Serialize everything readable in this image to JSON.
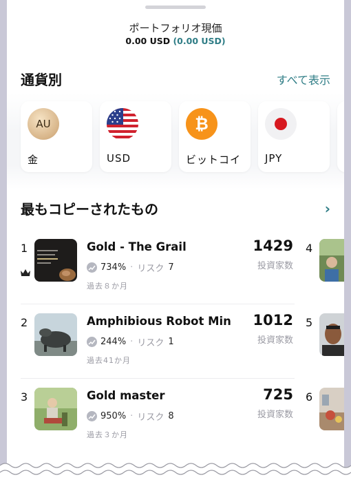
{
  "portfolio": {
    "title": "ポートフォリオ現価",
    "value": "0.00 USD",
    "change": "(0.00 USD)"
  },
  "currencies_section": {
    "title": "通貨別",
    "see_all": "すべて表示",
    "items": [
      {
        "label": "金",
        "icon": "gold-coin-icon",
        "icon_text": "AU"
      },
      {
        "label": "USD",
        "icon": "us-flag-icon"
      },
      {
        "label": "ビットコイ",
        "icon": "bitcoin-icon",
        "icon_text": "₿"
      },
      {
        "label": "JPY",
        "icon": "japan-flag-icon"
      }
    ]
  },
  "most_copied": {
    "title": "最もコピーされたもの",
    "rows": [
      {
        "rank": "1",
        "name": "Gold - The Grail",
        "return": "734%",
        "risk_label": "リスク",
        "risk": "7",
        "period": "過去８か月",
        "investors": "1429",
        "investors_label": "投資家数"
      },
      {
        "rank": "2",
        "name": "Amphibious Robot Min",
        "return": "244%",
        "risk_label": "リスク",
        "risk": "1",
        "period": "過去41か月",
        "investors": "1012",
        "investors_label": "投資家数"
      },
      {
        "rank": "3",
        "name": "Gold master",
        "return": "950%",
        "risk_label": "リスク",
        "risk": "8",
        "period": "過去３か月",
        "investors": "725",
        "investors_label": "投資家数"
      }
    ],
    "side_ranks": [
      "4",
      "5",
      "6"
    ]
  },
  "colors": {
    "accent": "#2f7d86",
    "bitcoin": "#f7931a",
    "muted": "#9a9aa3",
    "frame": "#c9c8d7"
  }
}
